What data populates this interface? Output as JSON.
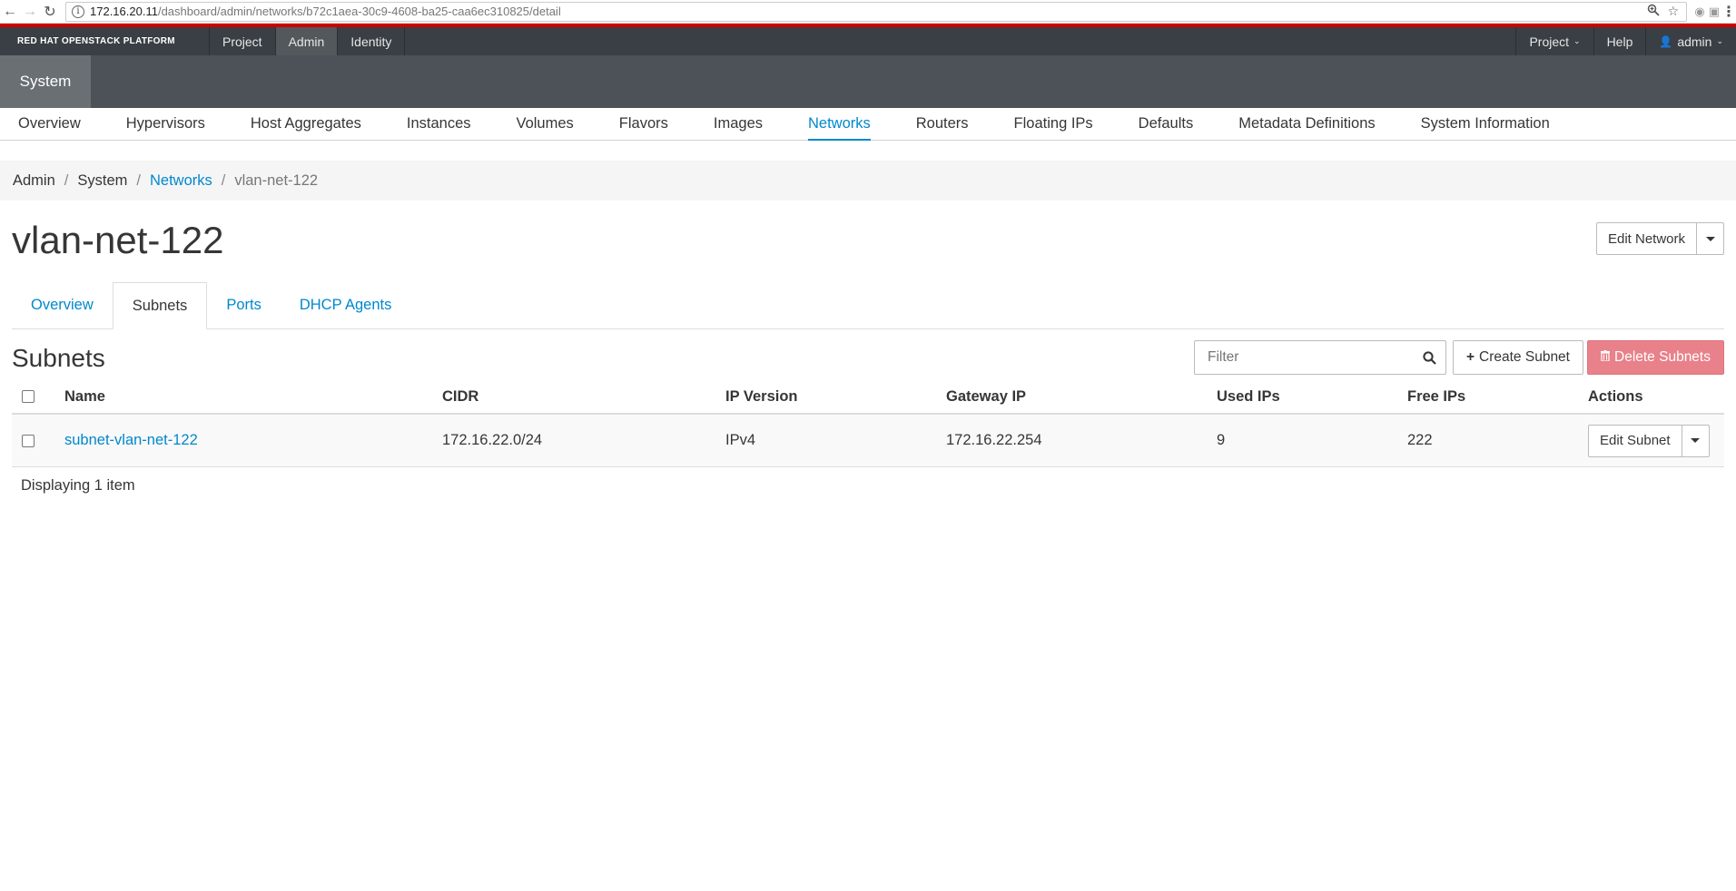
{
  "browser": {
    "url_host": "172.16.20.11",
    "url_path": "/dashboard/admin/networks/b72c1aea-30c9-4608-ba25-caa6ec310825/detail"
  },
  "topnav": {
    "brand": "RED HAT OPENSTACK PLATFORM",
    "items": [
      "Project",
      "Admin",
      "Identity"
    ],
    "active": "Admin",
    "right_project": "Project",
    "right_help": "Help",
    "right_user": "admin"
  },
  "system_tab": "System",
  "subnav": {
    "items": [
      "Overview",
      "Hypervisors",
      "Host Aggregates",
      "Instances",
      "Volumes",
      "Flavors",
      "Images",
      "Networks",
      "Routers",
      "Floating IPs",
      "Defaults",
      "Metadata Definitions",
      "System Information"
    ],
    "active": "Networks"
  },
  "breadcrumb": [
    "Admin",
    "System",
    "Networks",
    "vlan-net-122"
  ],
  "page": {
    "title": "vlan-net-122",
    "edit_network": "Edit Network"
  },
  "tabs": [
    "Overview",
    "Subnets",
    "Ports",
    "DHCP Agents"
  ],
  "active_tab": "Subnets",
  "subnets": {
    "title": "Subnets",
    "filter_placeholder": "Filter",
    "create_label": "Create Subnet",
    "delete_label": "Delete Subnets",
    "columns": [
      "Name",
      "CIDR",
      "IP Version",
      "Gateway IP",
      "Used IPs",
      "Free IPs",
      "Actions"
    ],
    "rows": [
      {
        "name": "subnet-vlan-net-122",
        "cidr": "172.16.22.0/24",
        "ip_version": "IPv4",
        "gateway": "172.16.22.254",
        "used_ips": "9",
        "free_ips": "222",
        "action": "Edit Subnet"
      }
    ],
    "footer": "Displaying 1 item"
  },
  "colors": {
    "link": "#0088ce",
    "danger": "#e8818a",
    "topbar": "#393f44",
    "accent_red": "#cc0000"
  }
}
